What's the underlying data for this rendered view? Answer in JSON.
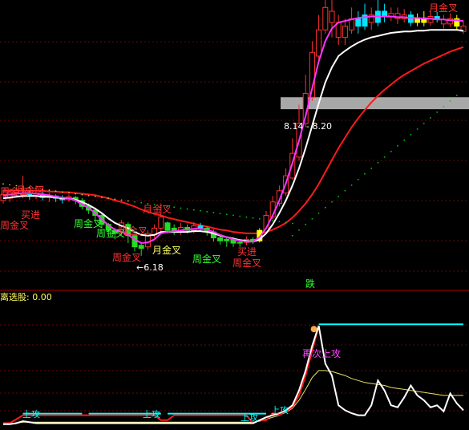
{
  "colors": {
    "background": "#000000",
    "grid": "#7a0000",
    "separator": "#b00000",
    "up_candle": "#ff3030",
    "down_candle": "#00e5ff",
    "green_candle": "#22dd22",
    "yellow_candle": "#ffff00",
    "ma_white": "#ffffff",
    "ma_magenta": "#ff33ff",
    "ma_red": "#ff1a1a",
    "dots": "#00cc00",
    "label_red": "#ff3333",
    "label_yellow": "#ffff66",
    "label_green": "#33ff33",
    "label_cyan": "#00ffff",
    "label_magenta": "#ff44ff",
    "indicator_red": "#ff1a1a",
    "indicator_cyan": "#00ffff",
    "indicator_yellow": "#e8e060",
    "band_highlight": "#a8a8a8"
  },
  "labels": {
    "price_low": "←6.18",
    "price_band": "8.14 - 8.20",
    "drop_marker": "跌",
    "panel_title": "离选股: 0.00",
    "second_attack": "再次上攻",
    "attack": "上攻"
  },
  "main_annotations": [
    {
      "text": "周金叉",
      "color": "label_red"
    },
    {
      "text": "买进",
      "color": "label_red"
    },
    {
      "text": "周金叉",
      "color": "label_red"
    },
    {
      "text": "周金叉",
      "color": "label_green"
    },
    {
      "text": "月金叉",
      "color": "label_red"
    },
    {
      "text": "月金叉",
      "color": "label_red"
    },
    {
      "text": "周金叉",
      "color": "label_green"
    },
    {
      "text": "月金叉",
      "color": "label_yellow"
    },
    {
      "text": "周金叉",
      "color": "label_red"
    },
    {
      "text": "周金叉",
      "color": "label_green"
    },
    {
      "text": "月金叉",
      "color": "label_red"
    },
    {
      "text": "买进",
      "color": "label_red"
    },
    {
      "text": "周金叉",
      "color": "label_red"
    },
    {
      "text": "月金叉",
      "color": "label_red"
    }
  ],
  "chart_data": {
    "type": "line",
    "title": "",
    "xlabel": "",
    "ylabel": "",
    "ylim": [
      5.9,
      9.6
    ],
    "annotations": [
      "←6.18",
      "8.14 - 8.20",
      "跌",
      "离选股: 0.00",
      "再次上攻",
      "上攻",
      "周金叉",
      "月金叉",
      "买进"
    ],
    "candles": [
      {
        "o": 7.0,
        "c": 6.92,
        "h": 7.05,
        "l": 6.88,
        "kind": "up"
      },
      {
        "o": 6.95,
        "c": 7.03,
        "h": 7.08,
        "l": 6.9,
        "kind": "up"
      },
      {
        "o": 7.02,
        "c": 7.05,
        "h": 7.1,
        "l": 6.98,
        "kind": "up"
      },
      {
        "o": 7.0,
        "c": 7.02,
        "h": 7.25,
        "l": 6.95,
        "kind": "up"
      },
      {
        "o": 7.01,
        "c": 6.98,
        "h": 7.06,
        "l": 6.93,
        "kind": "down"
      },
      {
        "o": 6.98,
        "c": 7.02,
        "h": 7.12,
        "l": 6.94,
        "kind": "up"
      },
      {
        "o": 7.0,
        "c": 6.96,
        "h": 7.04,
        "l": 6.92,
        "kind": "down"
      },
      {
        "o": 6.96,
        "c": 6.99,
        "h": 7.02,
        "l": 6.9,
        "kind": "up"
      },
      {
        "o": 6.98,
        "c": 6.95,
        "h": 7.0,
        "l": 6.9,
        "kind": "down"
      },
      {
        "o": 6.95,
        "c": 6.93,
        "h": 6.99,
        "l": 6.88,
        "kind": "down"
      },
      {
        "o": 6.93,
        "c": 6.97,
        "h": 7.0,
        "l": 6.9,
        "kind": "up"
      },
      {
        "o": 6.96,
        "c": 6.92,
        "h": 6.98,
        "l": 6.87,
        "kind": "green"
      },
      {
        "o": 6.92,
        "c": 6.84,
        "h": 6.95,
        "l": 6.8,
        "kind": "green"
      },
      {
        "o": 6.85,
        "c": 6.79,
        "h": 6.88,
        "l": 6.74,
        "kind": "green"
      },
      {
        "o": 6.79,
        "c": 6.72,
        "h": 6.82,
        "l": 6.66,
        "kind": "green"
      },
      {
        "o": 6.72,
        "c": 6.6,
        "h": 6.75,
        "l": 6.55,
        "kind": "green"
      },
      {
        "o": 6.6,
        "c": 6.52,
        "h": 6.62,
        "l": 6.45,
        "kind": "green"
      },
      {
        "o": 6.52,
        "c": 6.48,
        "h": 6.55,
        "l": 6.4,
        "kind": "green"
      },
      {
        "o": 6.5,
        "c": 6.62,
        "h": 6.66,
        "l": 6.45,
        "kind": "up"
      },
      {
        "o": 6.6,
        "c": 6.45,
        "h": 6.63,
        "l": 6.35,
        "kind": "green"
      },
      {
        "o": 6.45,
        "c": 6.3,
        "h": 6.48,
        "l": 6.24,
        "kind": "green"
      },
      {
        "o": 6.32,
        "c": 6.28,
        "h": 6.36,
        "l": 6.18,
        "kind": "green"
      },
      {
        "o": 6.3,
        "c": 6.48,
        "h": 6.52,
        "l": 6.26,
        "kind": "up"
      },
      {
        "o": 6.46,
        "c": 6.55,
        "h": 6.6,
        "l": 6.42,
        "kind": "up"
      },
      {
        "o": 6.55,
        "c": 6.7,
        "h": 6.88,
        "l": 6.5,
        "kind": "up"
      },
      {
        "o": 6.62,
        "c": 6.52,
        "h": 6.64,
        "l": 6.48,
        "kind": "green"
      },
      {
        "o": 6.55,
        "c": 6.5,
        "h": 6.6,
        "l": 6.46,
        "kind": "green"
      },
      {
        "o": 6.5,
        "c": 6.56,
        "h": 6.62,
        "l": 6.46,
        "kind": "up"
      },
      {
        "o": 6.56,
        "c": 6.52,
        "h": 6.6,
        "l": 6.48,
        "kind": "green"
      },
      {
        "o": 6.52,
        "c": 6.58,
        "h": 6.63,
        "l": 6.48,
        "kind": "up"
      },
      {
        "o": 6.58,
        "c": 6.55,
        "h": 6.62,
        "l": 6.5,
        "kind": "down"
      },
      {
        "o": 6.55,
        "c": 6.5,
        "h": 6.58,
        "l": 6.45,
        "kind": "green"
      },
      {
        "o": 6.5,
        "c": 6.42,
        "h": 6.53,
        "l": 6.37,
        "kind": "green"
      },
      {
        "o": 6.42,
        "c": 6.38,
        "h": 6.46,
        "l": 6.33,
        "kind": "green"
      },
      {
        "o": 6.38,
        "c": 6.4,
        "h": 6.44,
        "l": 6.3,
        "kind": "green"
      },
      {
        "o": 6.4,
        "c": 6.35,
        "h": 6.43,
        "l": 6.3,
        "kind": "green"
      },
      {
        "o": 6.35,
        "c": 6.36,
        "h": 6.4,
        "l": 6.3,
        "kind": "green"
      },
      {
        "o": 6.36,
        "c": 6.4,
        "h": 6.44,
        "l": 6.32,
        "kind": "up"
      },
      {
        "o": 6.4,
        "c": 6.38,
        "h": 6.43,
        "l": 6.34,
        "kind": "green"
      },
      {
        "o": 6.38,
        "c": 6.52,
        "h": 6.55,
        "l": 6.36,
        "kind": "yellow"
      },
      {
        "o": 6.5,
        "c": 6.72,
        "h": 6.78,
        "l": 6.48,
        "kind": "up"
      },
      {
        "o": 6.7,
        "c": 6.9,
        "h": 6.98,
        "l": 6.66,
        "kind": "up"
      },
      {
        "o": 6.88,
        "c": 7.05,
        "h": 7.12,
        "l": 6.84,
        "kind": "up"
      },
      {
        "o": 7.02,
        "c": 7.25,
        "h": 7.35,
        "l": 6.98,
        "kind": "up"
      },
      {
        "o": 7.22,
        "c": 7.55,
        "h": 7.75,
        "l": 7.2,
        "kind": "up"
      },
      {
        "o": 7.5,
        "c": 7.95,
        "h": 8.2,
        "l": 7.45,
        "kind": "up"
      },
      {
        "o": 7.95,
        "c": 8.35,
        "h": 8.6,
        "l": 7.9,
        "kind": "up"
      },
      {
        "o": 8.3,
        "c": 8.9,
        "h": 9.05,
        "l": 8.25,
        "kind": "up"
      },
      {
        "o": 8.85,
        "c": 9.2,
        "h": 9.4,
        "l": 8.8,
        "kind": "up"
      },
      {
        "o": 9.2,
        "c": 9.5,
        "h": 9.62,
        "l": 9.15,
        "kind": "up"
      },
      {
        "o": 9.45,
        "c": 9.3,
        "h": 9.6,
        "l": 9.1,
        "kind": "up"
      },
      {
        "o": 9.3,
        "c": 9.1,
        "h": 9.4,
        "l": 9.0,
        "kind": "up"
      },
      {
        "o": 9.1,
        "c": 9.25,
        "h": 9.35,
        "l": 9.0,
        "kind": "up"
      },
      {
        "o": 9.2,
        "c": 9.35,
        "h": 9.5,
        "l": 9.15,
        "kind": "up"
      },
      {
        "o": 9.35,
        "c": 9.25,
        "h": 9.45,
        "l": 9.15,
        "kind": "down"
      },
      {
        "o": 9.25,
        "c": 9.4,
        "h": 9.55,
        "l": 9.2,
        "kind": "down"
      },
      {
        "o": 9.4,
        "c": 9.3,
        "h": 9.5,
        "l": 9.2,
        "kind": "up"
      },
      {
        "o": 9.3,
        "c": 9.45,
        "h": 9.6,
        "l": 9.25,
        "kind": "down"
      },
      {
        "o": 9.45,
        "c": 9.38,
        "h": 9.55,
        "l": 9.3,
        "kind": "down"
      },
      {
        "o": 9.38,
        "c": 9.42,
        "h": 9.5,
        "l": 9.32,
        "kind": "up"
      },
      {
        "o": 9.42,
        "c": 9.35,
        "h": 9.5,
        "l": 9.28,
        "kind": "up"
      },
      {
        "o": 9.35,
        "c": 9.4,
        "h": 9.48,
        "l": 9.3,
        "kind": "up"
      },
      {
        "o": 9.4,
        "c": 9.3,
        "h": 9.45,
        "l": 9.25,
        "kind": "down"
      },
      {
        "o": 9.3,
        "c": 9.36,
        "h": 9.42,
        "l": 9.25,
        "kind": "yellow"
      },
      {
        "o": 9.36,
        "c": 9.3,
        "h": 9.45,
        "l": 9.25,
        "kind": "yellow"
      },
      {
        "o": 9.3,
        "c": 9.38,
        "h": 9.45,
        "l": 9.26,
        "kind": "up"
      },
      {
        "o": 9.38,
        "c": 9.34,
        "h": 9.44,
        "l": 9.3,
        "kind": "down"
      },
      {
        "o": 9.34,
        "c": 9.28,
        "h": 9.4,
        "l": 9.22,
        "kind": "up"
      },
      {
        "o": 9.28,
        "c": 9.35,
        "h": 9.42,
        "l": 9.24,
        "kind": "up"
      },
      {
        "o": 9.35,
        "c": 9.25,
        "h": 9.4,
        "l": 9.2,
        "kind": "yellow"
      },
      {
        "o": 9.25,
        "c": 9.18,
        "h": 9.32,
        "l": 9.15,
        "kind": "up"
      }
    ],
    "series": [
      {
        "values": [
          6.95,
          6.96,
          6.97,
          6.98,
          6.98,
          6.98,
          6.97,
          6.97,
          6.96,
          6.95,
          6.95,
          6.93,
          6.9,
          6.86,
          6.81,
          6.75,
          6.68,
          6.62,
          6.58,
          6.55,
          6.5,
          6.46,
          6.45,
          6.46,
          6.5,
          6.5,
          6.5,
          6.5,
          6.5,
          6.51,
          6.51,
          6.5,
          6.48,
          6.45,
          6.43,
          6.41,
          6.39,
          6.38,
          6.37,
          6.4,
          6.48,
          6.6,
          6.75,
          6.92,
          7.12,
          7.35,
          7.62,
          7.92,
          8.22,
          8.5,
          8.7,
          8.85,
          8.92,
          8.98,
          9.03,
          9.07,
          9.1,
          9.12,
          9.14,
          9.16,
          9.17,
          9.18,
          9.18,
          9.19,
          9.19,
          9.2,
          9.2,
          9.2,
          9.2,
          9.2,
          9.19
        ]
      },
      {
        "values": [
          6.98,
          7.0,
          7.01,
          7.02,
          7.02,
          7.01,
          7.0,
          6.99,
          6.97,
          6.96,
          6.95,
          6.92,
          6.87,
          6.82,
          6.75,
          6.67,
          6.59,
          6.53,
          6.5,
          6.46,
          6.4,
          6.35,
          6.36,
          6.4,
          6.48,
          6.5,
          6.51,
          6.52,
          6.53,
          6.54,
          6.54,
          6.53,
          6.5,
          6.46,
          6.43,
          6.4,
          6.38,
          6.37,
          6.37,
          6.43,
          6.55,
          6.72,
          6.92,
          7.15,
          7.42,
          7.72,
          8.05,
          8.42,
          8.78,
          9.05,
          9.22,
          9.3,
          9.32,
          9.34,
          9.36,
          9.37,
          9.38,
          9.38,
          9.38,
          9.38,
          9.37,
          9.37,
          9.36,
          9.36,
          9.35,
          9.35,
          9.34,
          9.34,
          9.33,
          9.33,
          9.32
        ]
      },
      {
        "values": [
          7.05,
          7.05,
          7.05,
          7.05,
          7.05,
          7.05,
          7.05,
          7.04,
          7.04,
          7.03,
          7.03,
          7.02,
          7.01,
          7.0,
          6.99,
          6.97,
          6.95,
          6.92,
          6.9,
          6.87,
          6.84,
          6.8,
          6.77,
          6.74,
          6.72,
          6.69,
          6.67,
          6.65,
          6.63,
          6.61,
          6.59,
          6.57,
          6.55,
          6.53,
          6.52,
          6.5,
          6.49,
          6.48,
          6.48,
          6.48,
          6.5,
          6.53,
          6.57,
          6.62,
          6.69,
          6.78,
          6.88,
          7.0,
          7.14,
          7.3,
          7.46,
          7.62,
          7.76,
          7.9,
          8.02,
          8.13,
          8.23,
          8.32,
          8.4,
          8.47,
          8.54,
          8.6,
          8.65,
          8.7,
          8.75,
          8.79,
          8.83,
          8.87,
          8.91,
          8.94,
          8.97
        ]
      }
    ],
    "indicator": {
      "red": [
        0.02,
        0.02,
        0.06,
        0.1,
        0.1,
        0.1,
        0.1,
        0.1,
        0.1,
        0.1,
        0.1,
        0.1,
        0.1,
        0.1,
        0.1,
        0.1,
        0.1,
        0.1,
        0.1,
        0.1,
        0.1,
        0.1,
        0.1,
        0.1,
        0.05,
        0.05,
        0.1,
        0.1,
        0.1,
        0.1,
        0.1,
        0.1,
        0.1,
        0.1,
        0.1,
        0.1,
        0.1,
        0.1,
        0.02,
        0.05,
        0.05,
        0.12,
        0.1,
        0.14,
        0.18,
        0.3,
        0.5,
        0.75,
        1.0
      ],
      "cyan_levels": [
        {
          "from": 3,
          "to": 12,
          "value": 0.1
        },
        {
          "from": 13,
          "to": 24,
          "value": 0.1
        },
        {
          "from": 25,
          "to": 40,
          "value": 0.1
        },
        {
          "from": 48,
          "to": 70,
          "value": 1.0
        }
      ],
      "white": [
        0.01,
        0.01,
        0.02,
        0.04,
        0.03,
        0.02,
        0.02,
        0.02,
        0.02,
        0.02,
        0.02,
        0.02,
        0.02,
        0.02,
        0.02,
        0.02,
        0.02,
        0.02,
        0.02,
        0.02,
        0.02,
        0.02,
        0.02,
        0.02,
        0.02,
        0.02,
        0.02,
        0.02,
        0.02,
        0.02,
        0.02,
        0.02,
        0.02,
        0.02,
        0.02,
        0.02,
        0.02,
        0.02,
        0.02,
        0.05,
        0.08,
        0.1,
        0.12,
        0.15,
        0.2,
        0.35,
        0.55,
        0.8,
        1.0,
        0.62,
        0.5,
        0.2,
        0.15,
        0.12,
        0.1,
        0.1,
        0.2,
        0.45,
        0.35,
        0.2,
        0.18,
        0.28,
        0.4,
        0.3,
        0.25,
        0.18,
        0.2,
        0.14,
        0.32,
        0.22,
        0.15
      ],
      "yellow": [
        0.02,
        0.02,
        0.02,
        0.03,
        0.03,
        0.03,
        0.03,
        0.03,
        0.03,
        0.03,
        0.03,
        0.03,
        0.03,
        0.03,
        0.03,
        0.03,
        0.03,
        0.03,
        0.03,
        0.03,
        0.03,
        0.03,
        0.03,
        0.03,
        0.03,
        0.03,
        0.03,
        0.03,
        0.03,
        0.03,
        0.03,
        0.03,
        0.03,
        0.03,
        0.03,
        0.03,
        0.03,
        0.03,
        0.03,
        0.04,
        0.06,
        0.08,
        0.1,
        0.13,
        0.17,
        0.25,
        0.36,
        0.48,
        0.55,
        0.55,
        0.54,
        0.52,
        0.5,
        0.47,
        0.45,
        0.43,
        0.42,
        0.41,
        0.4,
        0.38,
        0.37,
        0.36,
        0.35,
        0.34,
        0.33,
        0.32,
        0.31,
        0.3,
        0.3,
        0.3,
        0.3
      ],
      "ylim": [
        0,
        1.05
      ]
    }
  }
}
